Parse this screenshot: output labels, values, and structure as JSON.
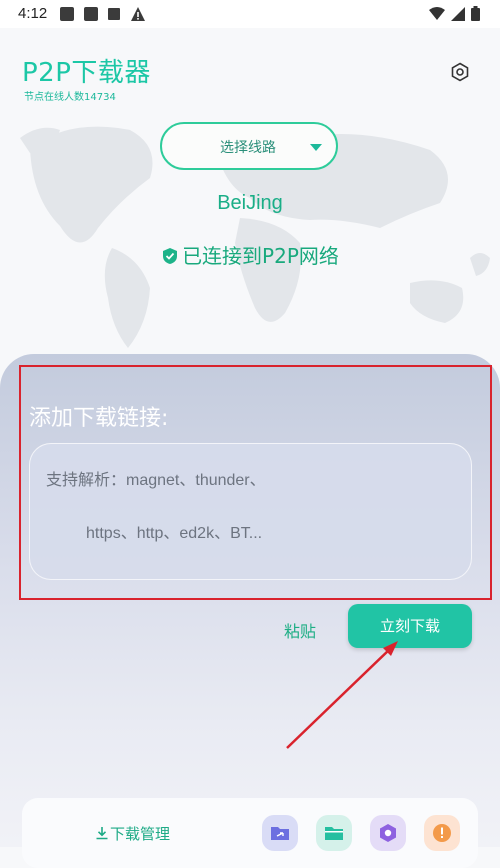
{
  "status_bar": {
    "time": "4:12"
  },
  "header": {
    "title": "P2P下载器",
    "node_count": "节点在线人数14734"
  },
  "route": {
    "label": "选择线路"
  },
  "location": {
    "city": "BeiJing",
    "connection_status": "已连接到P2P网络"
  },
  "panel": {
    "title": "添加下载链接:",
    "placeholder_line1": "支持解析：magnet、thunder、",
    "placeholder_line2": "https、http、ed2k、BT..."
  },
  "actions": {
    "paste_label": "粘贴",
    "download_label": "立刻下载"
  },
  "bottom": {
    "manager_label": "下载管理"
  },
  "colors": {
    "accent": "#21c4a5",
    "highlight": "#d9232d"
  }
}
